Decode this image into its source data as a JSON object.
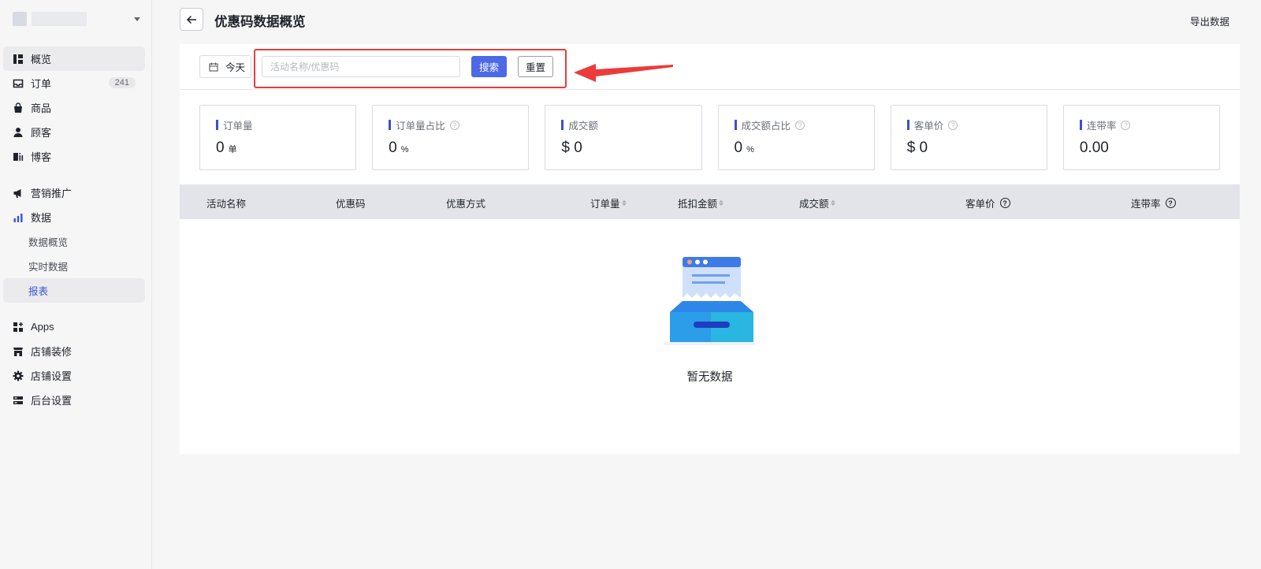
{
  "sidebar": {
    "items": [
      {
        "label": "概览",
        "icon": "overview-icon"
      },
      {
        "label": "订单",
        "icon": "inbox-icon",
        "badge": "241"
      },
      {
        "label": "商品",
        "icon": "bag-icon"
      },
      {
        "label": "顾客",
        "icon": "user-icon"
      },
      {
        "label": "博客",
        "icon": "blog-icon"
      },
      {
        "label": "营销推广",
        "icon": "megaphone-icon"
      },
      {
        "label": "数据",
        "icon": "bar-chart-icon"
      },
      {
        "label": "Apps",
        "icon": "apps-icon"
      },
      {
        "label": "店铺装修",
        "icon": "store-icon"
      },
      {
        "label": "店铺设置",
        "icon": "gear-icon"
      },
      {
        "label": "后台设置",
        "icon": "server-icon"
      }
    ],
    "data_sub": [
      {
        "label": "数据概览"
      },
      {
        "label": "实时数据"
      },
      {
        "label": "报表"
      }
    ]
  },
  "header": {
    "title": "优惠码数据概览",
    "export_label": "导出数据"
  },
  "filter": {
    "date_label": "今天",
    "search_placeholder": "活动名称/优惠码",
    "search_value": "",
    "search_button": "搜索",
    "reset_button": "重置",
    "highlight_color": "#ec3b3b"
  },
  "stats": [
    {
      "label": "订单量",
      "value": "0",
      "unit": "单",
      "help": false
    },
    {
      "label": "订单量占比",
      "value": "0",
      "unit": "%",
      "help": true
    },
    {
      "label": "成交额",
      "value": "$ 0",
      "unit": "",
      "help": false
    },
    {
      "label": "成交额占比",
      "value": "0",
      "unit": "%",
      "help": true
    },
    {
      "label": "客单价",
      "value": "$ 0",
      "unit": "",
      "help": true
    },
    {
      "label": "连带率",
      "value": "0.00",
      "unit": "",
      "help": true
    }
  ],
  "table": {
    "columns": [
      {
        "label": "活动名称"
      },
      {
        "label": "优惠码"
      },
      {
        "label": "优惠方式"
      },
      {
        "label": "订单量"
      },
      {
        "label": "抵扣金额"
      },
      {
        "label": "成交额"
      },
      {
        "label": "客单价"
      },
      {
        "label": "连带率"
      }
    ],
    "empty_text": "暂无数据"
  },
  "colors": {
    "accent": "#4d6ae6",
    "stat_bar": "#3b4fd1",
    "table_header_bg": "#e2e4ea",
    "active_sub_text": "#3a56d4"
  }
}
